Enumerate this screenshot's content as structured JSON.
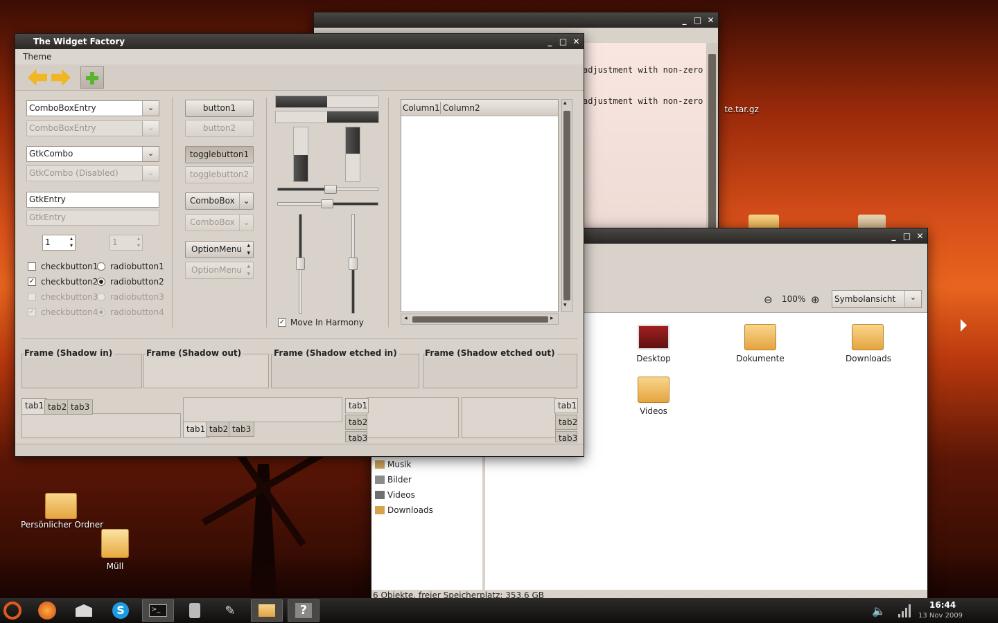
{
  "desktop": {
    "home_folder_label": "Persönlicher Ordner",
    "trash_label": "Müll",
    "archive_label": "te.tar.gz"
  },
  "terminal": {
    "line1": "adjustment with non-zero",
    "line2": "adjustment with non-zero"
  },
  "widget_factory": {
    "title": "The Widget Factory",
    "menu_theme": "Theme",
    "comboboxentry": "ComboBoxEntry",
    "comboboxentry_disabled": "ComboBoxEntry",
    "gtkcombo": "GtkCombo",
    "gtkcombo_disabled": "GtkCombo (Disabled)",
    "gtkentry": "GtkEntry",
    "gtkentry_disabled": "GtkEntry",
    "spin1": "1",
    "spin2": "1",
    "checkbutton1": "checkbutton1",
    "checkbutton2": "checkbutton2",
    "checkbutton3": "checkbutton3",
    "checkbutton4": "checkbutton4",
    "radiobutton1": "radiobutton1",
    "radiobutton2": "radiobutton2",
    "radiobutton3": "radiobutton3",
    "radiobutton4": "radiobutton4",
    "button1": "button1",
    "button2": "button2",
    "togglebutton1": "togglebutton1",
    "togglebutton2": "togglebutton2",
    "combobox": "ComboBox",
    "combobox_disabled": "ComboBox",
    "optionmenu": "OptionMenu",
    "optionmenu_disabled": "OptionMenu",
    "move_in_harmony": "Move In Harmony",
    "column1": "Column1",
    "column2": "Column2",
    "frame_shadow_in": "Frame (Shadow in)",
    "frame_shadow_out": "Frame (Shadow out)",
    "frame_shadow_etched_in": "Frame (Shadow etched in)",
    "frame_shadow_etched_out": "Frame (Shadow etched out)",
    "tab1": "tab1",
    "tab2": "tab2",
    "tab3": "tab3"
  },
  "file_manager": {
    "zoom_level": "100%",
    "view_mode": "Symbolansicht",
    "places": [
      "Musik",
      "Bilder",
      "Videos",
      "Downloads"
    ],
    "items": [
      "Desktop",
      "Dokumente",
      "Downloads",
      "Videos"
    ],
    "status": "6 Objekte, freier Speicherplatz: 353,6 GB"
  },
  "taskbar": {
    "time": "16:44",
    "date": "13 Nov 2009"
  }
}
